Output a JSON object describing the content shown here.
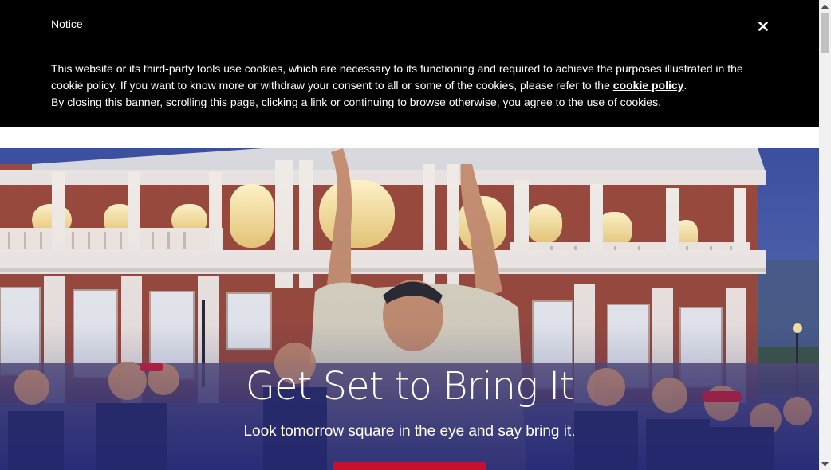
{
  "cookie_banner": {
    "title": "Notice",
    "close_icon": "close-icon",
    "text_part1": "This website or its third-party tools use cookies, which are necessary to its functioning and required to achieve the purposes illustrated in the cookie policy. If you want to know more or withdraw your consent to all or some of the cookies, please refer to the ",
    "link_label": "cookie policy",
    "text_part2": ".",
    "text_line3": "By closing this banner, scrolling this page, clicking a link or continuing to browse otherwise, you agree to the use of cookies."
  },
  "hero": {
    "title": "Get Set to Bring It",
    "subtitle": "Look tomorrow square in the eye and say bring it.",
    "cta_color": "#c8102e"
  },
  "scrollbar": {
    "up_icon": "scroll-up-arrow-icon",
    "down_icon": "scroll-down-arrow-icon"
  }
}
